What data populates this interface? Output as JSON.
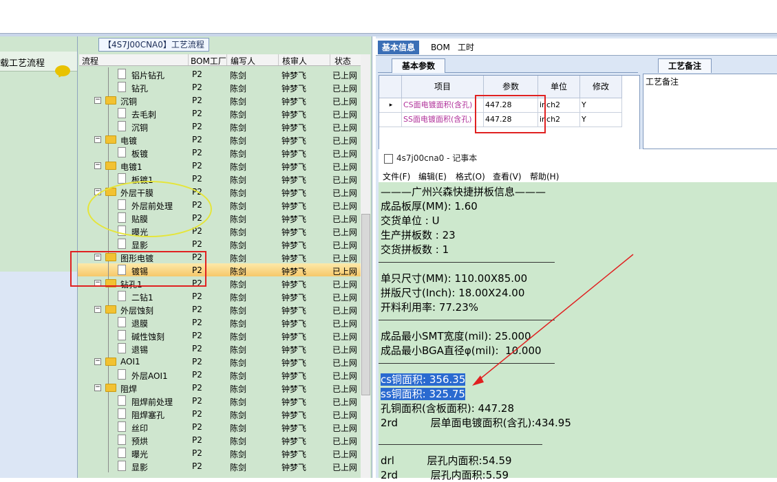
{
  "left_panel": {
    "title": "载工艺流程",
    "icon": "speech-bubble-icon"
  },
  "tree": {
    "title": "【4S7J00CNA0】工艺流程",
    "columns": [
      "流程",
      "BOM工厂",
      "编写人",
      "核审人",
      "状态"
    ],
    "rows": [
      {
        "level": 2,
        "type": "doc",
        "name": "铝片钻孔",
        "factory": "P2",
        "author": "陈剑",
        "reviewer": "钟梦飞",
        "status": "已上网"
      },
      {
        "level": 2,
        "type": "doc",
        "name": "钻孔",
        "factory": "P2",
        "author": "陈剑",
        "reviewer": "钟梦飞",
        "status": "已上网"
      },
      {
        "level": 1,
        "type": "folder",
        "name": "沉铜",
        "factory": "P2",
        "author": "陈剑",
        "reviewer": "钟梦飞",
        "status": "已上网"
      },
      {
        "level": 2,
        "type": "doc",
        "name": "去毛刺",
        "factory": "P2",
        "author": "陈剑",
        "reviewer": "钟梦飞",
        "status": "已上网"
      },
      {
        "level": 2,
        "type": "doc",
        "name": "沉铜",
        "factory": "P2",
        "author": "陈剑",
        "reviewer": "钟梦飞",
        "status": "已上网"
      },
      {
        "level": 1,
        "type": "folder",
        "name": "电镀",
        "factory": "P2",
        "author": "陈剑",
        "reviewer": "钟梦飞",
        "status": "已上网"
      },
      {
        "level": 2,
        "type": "doc",
        "name": "板镀",
        "factory": "P2",
        "author": "陈剑",
        "reviewer": "钟梦飞",
        "status": "已上网"
      },
      {
        "level": 1,
        "type": "folder",
        "name": "电镀1",
        "factory": "P2",
        "author": "陈剑",
        "reviewer": "钟梦飞",
        "status": "已上网"
      },
      {
        "level": 2,
        "type": "doc",
        "name": "板镀1",
        "factory": "P2",
        "author": "陈剑",
        "reviewer": "钟梦飞",
        "status": "已上网"
      },
      {
        "level": 1,
        "type": "folder",
        "name": "外层干膜",
        "factory": "P2",
        "author": "陈剑",
        "reviewer": "钟梦飞",
        "status": "已上网"
      },
      {
        "level": 2,
        "type": "doc",
        "name": "外层前处理",
        "factory": "P2",
        "author": "陈剑",
        "reviewer": "钟梦飞",
        "status": "已上网"
      },
      {
        "level": 2,
        "type": "doc",
        "name": "贴膜",
        "factory": "P2",
        "author": "陈剑",
        "reviewer": "钟梦飞",
        "status": "已上网"
      },
      {
        "level": 2,
        "type": "doc",
        "name": "曝光",
        "factory": "P2",
        "author": "陈剑",
        "reviewer": "钟梦飞",
        "status": "已上网"
      },
      {
        "level": 2,
        "type": "doc",
        "name": "显影",
        "factory": "P2",
        "author": "陈剑",
        "reviewer": "钟梦飞",
        "status": "已上网"
      },
      {
        "level": 1,
        "type": "folder",
        "name": "图形电镀",
        "factory": "P2",
        "author": "陈剑",
        "reviewer": "钟梦飞",
        "status": "已上网"
      },
      {
        "level": 2,
        "type": "doc",
        "name": "镀锡",
        "factory": "P2",
        "author": "陈剑",
        "reviewer": "钟梦飞",
        "status": "已上网",
        "selected": true
      },
      {
        "level": 1,
        "type": "folder",
        "name": "钻孔1",
        "factory": "P2",
        "author": "陈剑",
        "reviewer": "钟梦飞",
        "status": "已上网"
      },
      {
        "level": 2,
        "type": "doc",
        "name": "二钻1",
        "factory": "P2",
        "author": "陈剑",
        "reviewer": "钟梦飞",
        "status": "已上网"
      },
      {
        "level": 1,
        "type": "folder",
        "name": "外层蚀刻",
        "factory": "P2",
        "author": "陈剑",
        "reviewer": "钟梦飞",
        "status": "已上网"
      },
      {
        "level": 2,
        "type": "doc",
        "name": "退膜",
        "factory": "P2",
        "author": "陈剑",
        "reviewer": "钟梦飞",
        "status": "已上网"
      },
      {
        "level": 2,
        "type": "doc",
        "name": "碱性蚀刻",
        "factory": "P2",
        "author": "陈剑",
        "reviewer": "钟梦飞",
        "status": "已上网"
      },
      {
        "level": 2,
        "type": "doc",
        "name": "退锡",
        "factory": "P2",
        "author": "陈剑",
        "reviewer": "钟梦飞",
        "status": "已上网"
      },
      {
        "level": 1,
        "type": "folder",
        "name": "AOI1",
        "factory": "P2",
        "author": "陈剑",
        "reviewer": "钟梦飞",
        "status": "已上网"
      },
      {
        "level": 2,
        "type": "doc",
        "name": "外层AOI1",
        "factory": "P2",
        "author": "陈剑",
        "reviewer": "钟梦飞",
        "status": "已上网"
      },
      {
        "level": 1,
        "type": "folder",
        "name": "阻焊",
        "factory": "P2",
        "author": "陈剑",
        "reviewer": "钟梦飞",
        "status": "已上网"
      },
      {
        "level": 2,
        "type": "doc",
        "name": "阻焊前处理",
        "factory": "P2",
        "author": "陈剑",
        "reviewer": "钟梦飞",
        "status": "已上网"
      },
      {
        "level": 2,
        "type": "doc",
        "name": "阻焊塞孔",
        "factory": "P2",
        "author": "陈剑",
        "reviewer": "钟梦飞",
        "status": "已上网"
      },
      {
        "level": 2,
        "type": "doc",
        "name": "丝印",
        "factory": "P2",
        "author": "陈剑",
        "reviewer": "钟梦飞",
        "status": "已上网"
      },
      {
        "level": 2,
        "type": "doc",
        "name": "预烘",
        "factory": "P2",
        "author": "陈剑",
        "reviewer": "钟梦飞",
        "status": "已上网"
      },
      {
        "level": 2,
        "type": "doc",
        "name": "曝光",
        "factory": "P2",
        "author": "陈剑",
        "reviewer": "钟梦飞",
        "status": "已上网"
      },
      {
        "level": 2,
        "type": "doc",
        "name": "显影",
        "factory": "P2",
        "author": "陈剑",
        "reviewer": "钟梦飞",
        "status": "已上网"
      }
    ]
  },
  "right": {
    "tabs": [
      "基本信息",
      "BOM",
      "工时"
    ],
    "subtab": "基本参数",
    "memo_tab": "工艺备注",
    "memo_label": "工艺备注",
    "grid": {
      "headers": [
        "项目",
        "参数",
        "单位",
        "修改"
      ],
      "rows": [
        {
          "item": "CS面电镀面积(含孔)",
          "param": "447.28",
          "unit": "inch2",
          "edit": "Y"
        },
        {
          "item": "SS面电镀面积(含孔)",
          "param": "447.28",
          "unit": "inch2",
          "edit": "Y"
        }
      ]
    }
  },
  "notepad": {
    "title": "4s7j00cna0 - 记事本",
    "menu": [
      "文件(F)",
      "编辑(E)",
      "格式(O)",
      "查看(V)",
      "帮助(H)"
    ],
    "lines": {
      "header": "———广州兴森快捷拼板信息———",
      "thickness": "成品板厚(MM): 1.60",
      "unit": "交货单位 : U",
      "prod_panels": "生产拼板数 : 23",
      "deliver_panels": "交货拼板数 : 1",
      "single_size": "单只尺寸(MM): 110.00X85.00",
      "panel_size": "拼版尺寸(Inch): 18.00X24.00",
      "utilization": "开料利用率: 77.23%",
      "smt": "成品最小SMT宽度(mil): 25.000",
      "bga": "成品最小BGA直径φ(mil):  10.000",
      "cs_copper": "cs铜面积: 356.35",
      "ss_copper": "ss铜面积: 325.75",
      "hole_copper": "孔铜面积(含板面积): 447.28",
      "layer2": "2rd          层单面电镀面积(含孔):434.95",
      "drl": "drl          层孔内面积:54.59",
      "last": "2rd          层孔内面积:5.59"
    }
  }
}
